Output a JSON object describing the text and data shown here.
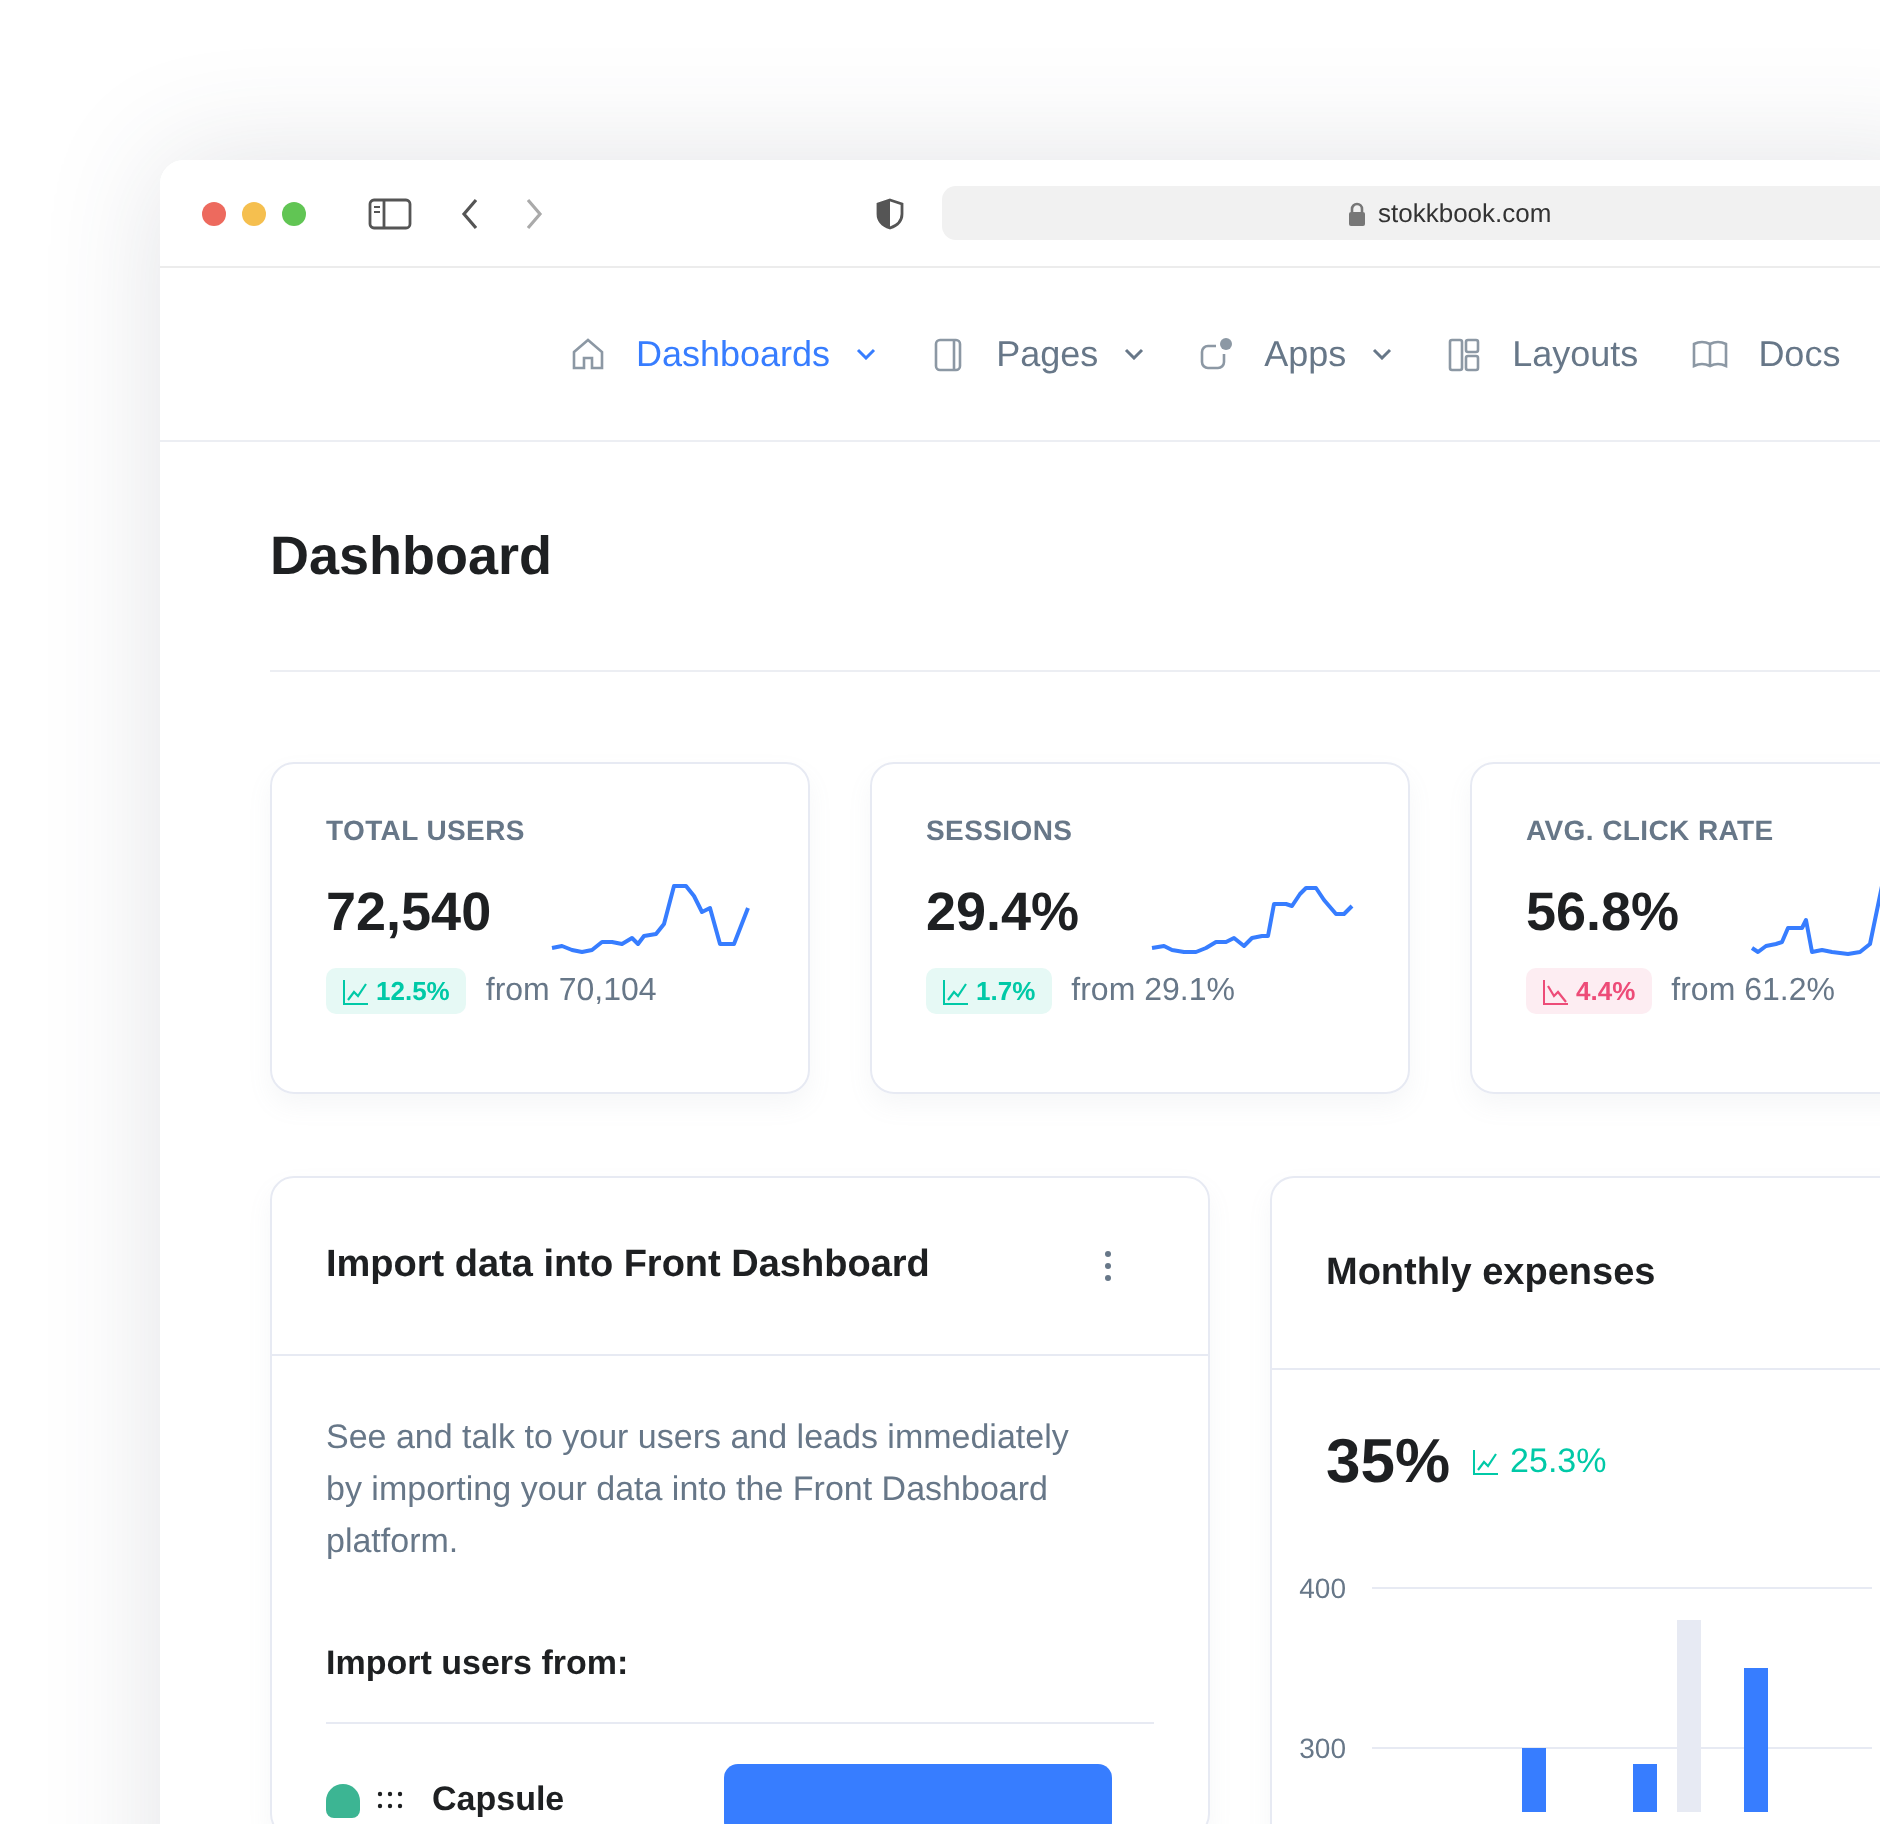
{
  "browser": {
    "address": "stokkbook.com"
  },
  "nav": {
    "items": [
      {
        "label": "Dashboards",
        "kind": "home",
        "selected": true,
        "dropdown": true
      },
      {
        "label": "Pages",
        "kind": "page",
        "selected": false,
        "dropdown": true
      },
      {
        "label": "Apps",
        "kind": "app",
        "selected": false,
        "dropdown": true
      },
      {
        "label": "Layouts",
        "kind": "layout",
        "selected": false,
        "dropdown": false
      },
      {
        "label": "Docs",
        "kind": "book",
        "selected": false,
        "dropdown": false
      }
    ]
  },
  "page": {
    "title": "Dashboard"
  },
  "stats": [
    {
      "label": "TOTAL USERS",
      "value": "72,540",
      "change": "12.5%",
      "kind": "up",
      "from": "from 70,104"
    },
    {
      "label": "SESSIONS",
      "value": "29.4%",
      "change": "1.7%",
      "kind": "up",
      "from": "from 29.1%"
    },
    {
      "label": "AVG. CLICK RATE",
      "value": "56.8%",
      "change": "4.4%",
      "kind": "down",
      "from": "from 61.2%"
    }
  ],
  "import_card": {
    "title": "Import data into Front Dashboard",
    "description": "See and talk to your users and leads immediately by importing your data into the Front Dashboard platform.",
    "subtitle": "Import users from:",
    "sources": [
      {
        "name": "Capsule"
      }
    ]
  },
  "expenses": {
    "title": "Monthly expenses",
    "value": "35%",
    "change": "25.3%",
    "kind": "up",
    "chart_data": {
      "type": "bar",
      "ylim": [
        260,
        400
      ],
      "yticks": [
        300,
        400
      ],
      "stacked": false,
      "series": [
        {
          "color": "#377dff",
          "values": [
            300,
            290,
            350
          ]
        },
        {
          "color": "#e7eaf3",
          "values": [
            null,
            380,
            null
          ]
        }
      ]
    }
  }
}
